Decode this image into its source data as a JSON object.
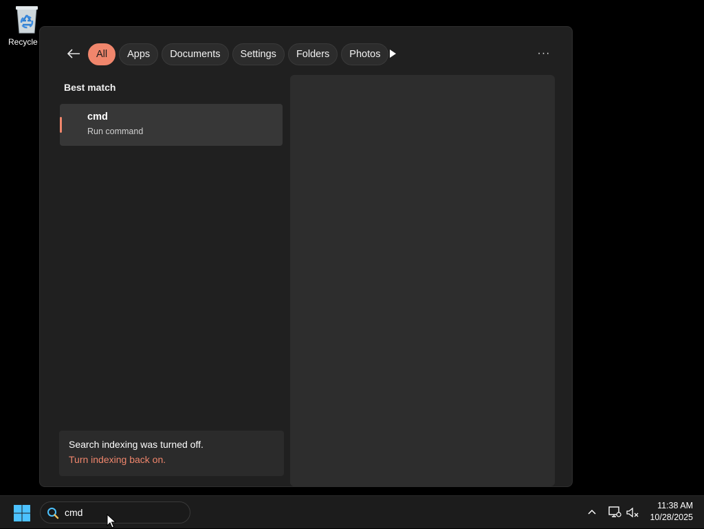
{
  "desktop": {
    "icons": [
      {
        "label": "Recycle B",
        "icon": "recycle-bin-icon"
      }
    ]
  },
  "search_panel": {
    "filters": [
      {
        "label": "All",
        "active": true
      },
      {
        "label": "Apps",
        "active": false
      },
      {
        "label": "Documents",
        "active": false
      },
      {
        "label": "Settings",
        "active": false
      },
      {
        "label": "Folders",
        "active": false
      },
      {
        "label": "Photos",
        "active": false
      }
    ],
    "more_label": "···",
    "section_title": "Best match",
    "best_match": {
      "title": "cmd",
      "subtitle": "Run command"
    },
    "indexing_notice": {
      "message": "Search indexing was turned off.",
      "link": "Turn indexing back on."
    }
  },
  "taskbar": {
    "search_value": "cmd",
    "clock": {
      "time": "11:38 AM",
      "date": "10/28/2025"
    }
  },
  "colors": {
    "accent": "#f0866c",
    "panel_bg": "#202020",
    "preview_bg": "#2d2d2d",
    "taskbar_bg": "#1c1c1c"
  }
}
